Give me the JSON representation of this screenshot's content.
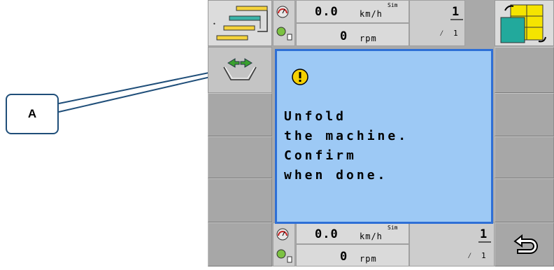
{
  "callout": {
    "label": "A"
  },
  "header": {
    "speed": "0.0",
    "speed_unit": "km/h",
    "sim": "Sim",
    "rpm": "0",
    "rpm_unit": "rpm",
    "count": "1",
    "count_sub": "1"
  },
  "dialog": {
    "message_lines": [
      "Unfold",
      "the machine.",
      "Confirm",
      "when done."
    ]
  },
  "footer": {
    "speed": "0.0",
    "speed_unit": "km/h",
    "sim": "Sim",
    "rpm": "0",
    "rpm_unit": "rpm",
    "count": "1",
    "count_sub": "1"
  },
  "colors": {
    "dialog_bg": "#9dc9f5",
    "dialog_border": "#2e6fd6",
    "warning": "#f5d000",
    "arrow": "#3aa12e"
  }
}
